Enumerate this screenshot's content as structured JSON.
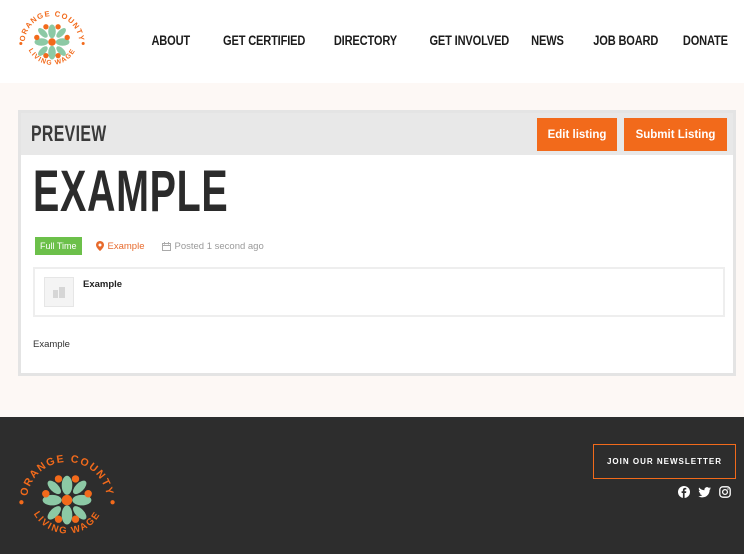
{
  "brand": {
    "logo_text_top": "ORANGE COUNTY",
    "logo_text_bottom": "LIVING WAGE",
    "colors": {
      "orange": "#f26a1b",
      "green": "#8cc9a5",
      "dark": "#2d2d2d",
      "badge_green": "#6cc04a"
    }
  },
  "nav": {
    "items": [
      {
        "label": "ABOUT"
      },
      {
        "label": "GET CERTIFIED"
      },
      {
        "label": "DIRECTORY"
      },
      {
        "label": "GET INVOLVED"
      },
      {
        "label": "NEWS"
      },
      {
        "label": "JOB BOARD"
      },
      {
        "label": "DONATE"
      }
    ]
  },
  "preview": {
    "heading": "PREVIEW",
    "edit_label": "Edit listing",
    "submit_label": "Submit Listing"
  },
  "job": {
    "title": "EXAMPLE",
    "type_badge": "Full Time",
    "location": "Example",
    "posted": "Posted 1 second ago",
    "company_name": "Example",
    "description": "Example",
    "icons": {
      "location": "map-pin-icon",
      "posted": "calendar-icon",
      "company": "building-icon"
    }
  },
  "footer": {
    "newsletter_label": "JOIN OUR NEWSLETTER",
    "social": [
      "facebook-icon",
      "twitter-icon",
      "instagram-icon"
    ]
  }
}
